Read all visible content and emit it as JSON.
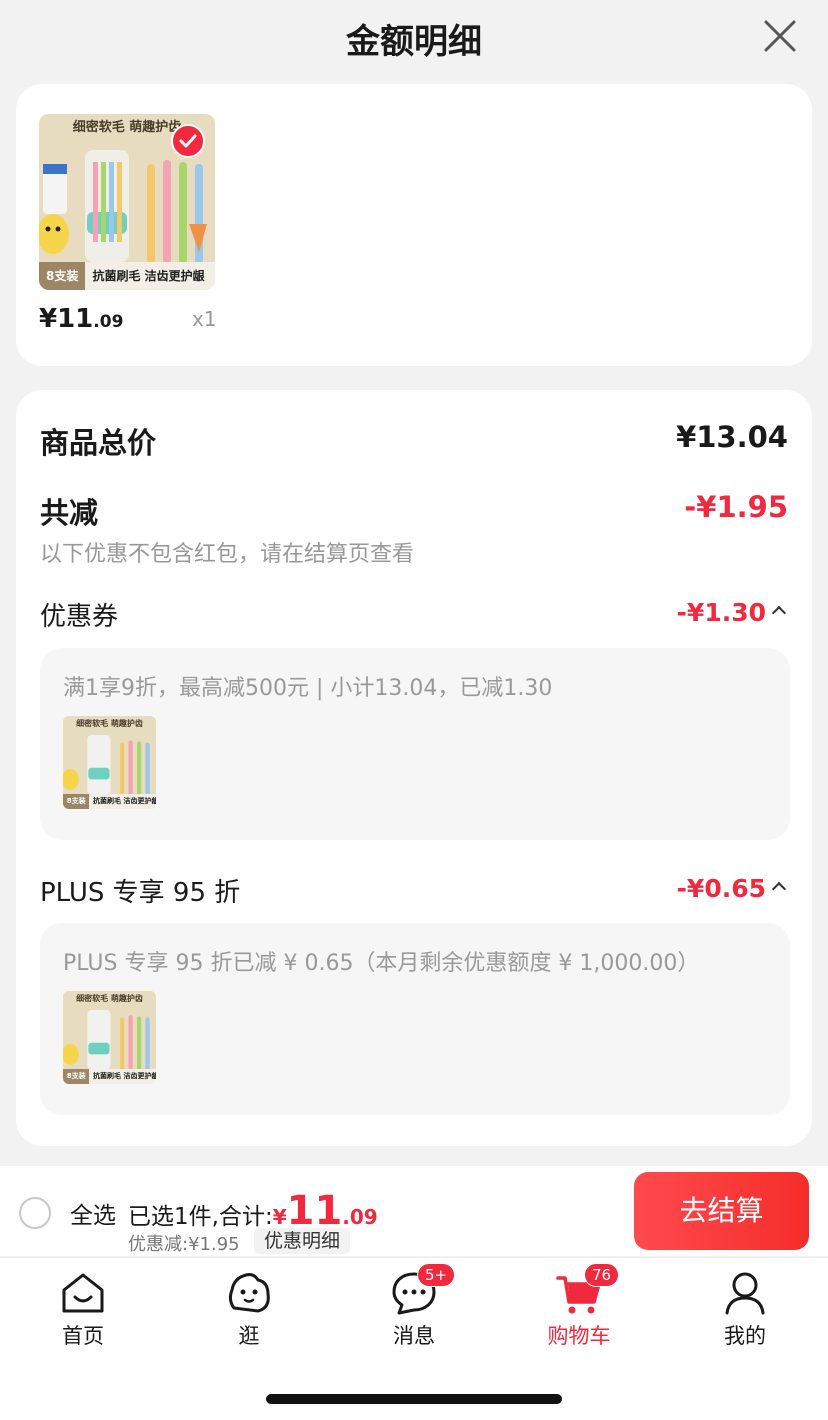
{
  "header": {
    "title": "金额明细"
  },
  "product": {
    "ribbon_top": "细密软毛 萌趣护齿",
    "ribbon_tag": "8支装",
    "ribbon_text": "抗菌刷毛 洁齿更护龈",
    "price_symbol": "¥",
    "price_int": "11",
    "price_dec": ".09",
    "qty": "x1"
  },
  "summary": {
    "total_label": "商品总价",
    "total_value": "¥13.04",
    "reduce_label": "共减",
    "reduce_value": "-¥1.95",
    "note": "以下优惠不包含红包，请在结算页查看"
  },
  "coupon": {
    "label": "优惠券",
    "value": "-¥1.30",
    "detail": "满1享9折，最高减500元 | 小计13.04，已减1.30"
  },
  "plus": {
    "label": "PLUS 专享 95 折",
    "value": "-¥0.65",
    "detail": "PLUS 专享 95 折已减 ¥ 0.65（本月剩余优惠额度 ¥ 1,000.00）"
  },
  "bottom_bar": {
    "select_all": "全选",
    "selected_text": "已选1件,合计:",
    "sum_currency": "¥",
    "sum_int": "11",
    "sum_dec": ".09",
    "discount_text": "优惠减:¥1.95",
    "detail_chip": "优惠明细",
    "checkout": "去结算"
  },
  "tabs": [
    {
      "label": "首页",
      "icon": "home-icon"
    },
    {
      "label": "逛",
      "icon": "explore-face-icon"
    },
    {
      "label": "消息",
      "icon": "message-icon",
      "badge": "5+"
    },
    {
      "label": "购物车",
      "icon": "cart-icon",
      "badge": "76",
      "active": true
    },
    {
      "label": "我的",
      "icon": "profile-icon"
    }
  ],
  "colors": {
    "accent": "#f0293e",
    "background": "#f2f2f2",
    "card": "#ffffff"
  }
}
